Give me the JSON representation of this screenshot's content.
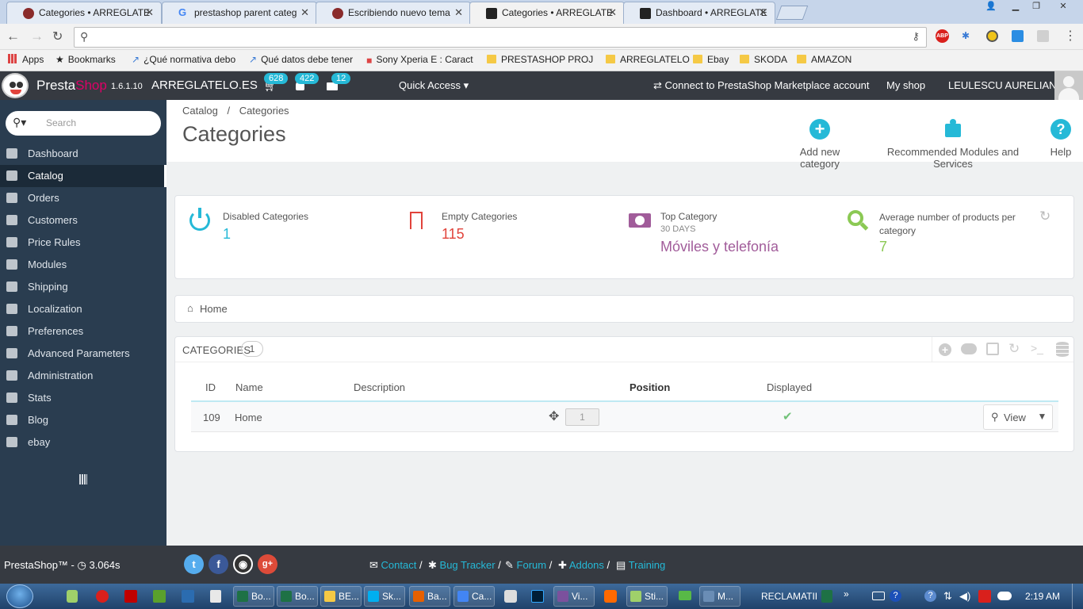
{
  "browser": {
    "tabs": [
      {
        "title": "Categories • ARREGLATE",
        "active": false
      },
      {
        "title": "prestashop parent categ",
        "active": false
      },
      {
        "title": "Escribiendo nuevo tema",
        "active": false
      },
      {
        "title": "Categories • ARREGLATE",
        "active": true
      },
      {
        "title": "Dashboard • ARREGLATE",
        "active": false
      }
    ],
    "address": "",
    "bookmarks": [
      {
        "label": "Apps",
        "icon": "apps-grid-icon"
      },
      {
        "label": "Bookmarks",
        "icon": "star-icon"
      },
      {
        "label": "¿Qué normativa debo",
        "icon": "page-icon"
      },
      {
        "label": "Qué datos debe tener",
        "icon": "page-icon"
      },
      {
        "label": "Sony Xperia E : Caract",
        "icon": "page-icon"
      },
      {
        "label": "PRESTASHOP PROJEC",
        "icon": "folder-icon"
      },
      {
        "label": "ARREGLATELO",
        "icon": "folder-icon"
      },
      {
        "label": "Ebay",
        "icon": "folder-icon"
      },
      {
        "label": "SKODA",
        "icon": "folder-icon"
      },
      {
        "label": "AMAZON",
        "icon": "folder-icon"
      }
    ],
    "ext_abp": "ABP"
  },
  "header": {
    "logo_presta": "Presta",
    "logo_shop": "Shop",
    "version": "1.6.1.10",
    "shop_name": "ARREGLATELO.ES",
    "badges": {
      "orders": "628",
      "customers": "422",
      "messages": "12"
    },
    "quick_access": "Quick Access",
    "marketplace": "Connect to PrestaShop Marketplace account",
    "my_shop": "My shop",
    "user": "LEULESCU AURELIAN"
  },
  "sidebar": {
    "search_placeholder": "Search",
    "items": [
      {
        "label": "Dashboard",
        "icon": "dashboard-icon"
      },
      {
        "label": "Catalog",
        "icon": "catalog-icon"
      },
      {
        "label": "Orders",
        "icon": "credit-card-icon"
      },
      {
        "label": "Customers",
        "icon": "users-icon"
      },
      {
        "label": "Price Rules",
        "icon": "tags-icon"
      },
      {
        "label": "Modules",
        "icon": "puzzle-icon"
      },
      {
        "label": "Shipping",
        "icon": "truck-icon"
      },
      {
        "label": "Localization",
        "icon": "globe-icon"
      },
      {
        "label": "Preferences",
        "icon": "wrench-icon"
      },
      {
        "label": "Advanced Parameters",
        "icon": "cogs-icon"
      },
      {
        "label": "Administration",
        "icon": "cog-icon"
      },
      {
        "label": "Stats",
        "icon": "bar-chart-icon"
      },
      {
        "label": "Blog",
        "icon": "edit-icon"
      },
      {
        "label": "ebay",
        "icon": "refresh-icon"
      }
    ],
    "active_index": 1
  },
  "page": {
    "breadcrumb": [
      "Catalog",
      "Categories"
    ],
    "title": "Categories",
    "toolbar": {
      "add": "Add new category",
      "recommended": "Recommended Modules and Services",
      "help": "Help"
    }
  },
  "kpis": [
    {
      "label": "Disabled Categories",
      "sub": "",
      "value": "1",
      "color": "#25b9d7",
      "icon": "power-icon"
    },
    {
      "label": "Empty Categories",
      "sub": "",
      "value": "115",
      "color": "#e1433b",
      "icon": "bookmark-icon"
    },
    {
      "label": "Top Category",
      "sub": "30 DAYS",
      "value": "Móviles y telefonía",
      "color": "#a15c9a",
      "icon": "money-icon"
    },
    {
      "label": "Average number of products per category",
      "sub": "",
      "value": "7",
      "color": "#8bc954",
      "icon": "search-icon"
    }
  ],
  "home_breadcrumb": "Home",
  "list": {
    "title": "CATEGORIES",
    "count": "1",
    "columns": [
      "ID",
      "Name",
      "Description",
      "Position",
      "Displayed"
    ],
    "rows": [
      {
        "id": "109",
        "name": "Home",
        "description": "",
        "position": "1",
        "displayed": "yes",
        "action": "View"
      }
    ]
  },
  "footer": {
    "brand": "PrestaShop™ - ",
    "timer": "3.064s",
    "links": [
      "Contact",
      "Bug Tracker",
      "Forum",
      "Addons",
      "Training"
    ]
  },
  "taskbar": {
    "tasks": [
      {
        "label": "Bo...",
        "color": "#1e7145"
      },
      {
        "label": "Bo...",
        "color": "#1e7145"
      },
      {
        "label": "BE...",
        "color": "#f5c945"
      },
      {
        "label": "Sk...",
        "color": "#00aff0"
      },
      {
        "label": "Ba...",
        "color": "#e66000"
      },
      {
        "label": "Ca...",
        "color": "#4285f4"
      },
      {
        "label": "Vi...",
        "color": "#7b519d"
      },
      {
        "label": "Sti...",
        "color": "#9fd06a"
      },
      {
        "label": "M...",
        "color": "#6a8db5"
      }
    ],
    "reclam": "RECLAMATII",
    "clock": "2:19 AM"
  }
}
